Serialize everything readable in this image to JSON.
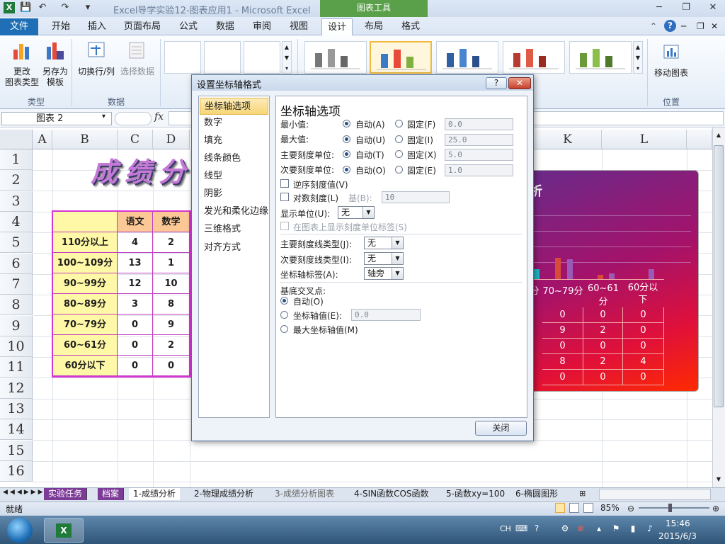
{
  "window": {
    "title": "Excel导学实验12-图表应用1 - Microsoft Excel",
    "chart_tools": "图表工具"
  },
  "ribbon": {
    "tabs": [
      "文件",
      "开始",
      "插入",
      "页面布局",
      "公式",
      "数据",
      "审阅",
      "视图",
      "设计",
      "布局",
      "格式"
    ],
    "btn_change_type": "更改\n图表类型",
    "btn_change_type_l1": "更改",
    "btn_change_type_l2": "图表类型",
    "btn_save_template_l1": "另存为",
    "btn_save_template_l2": "模板",
    "btn_switch": "切换行/列",
    "btn_select_data": "选择数据",
    "btn_move_chart": "移动图表",
    "group_type": "类型",
    "group_data": "数据",
    "group_location": "位置"
  },
  "formula": {
    "namebox": "图表 2",
    "fx": "fx"
  },
  "sheet": {
    "columns": [
      "A",
      "B",
      "C",
      "D",
      "K",
      "L"
    ],
    "rows": [
      "1",
      "2",
      "3",
      "4",
      "5",
      "6",
      "7",
      "8",
      "9",
      "10",
      "11",
      "12",
      "13",
      "14",
      "15",
      "16"
    ],
    "title_text": "成绩分",
    "table_headers": [
      "语文",
      "数学"
    ],
    "table_rows": [
      {
        "label": "110分以上",
        "c": "4",
        "d": "2"
      },
      {
        "label": "100~109分",
        "c": "13",
        "d": "1"
      },
      {
        "label": "90~99分",
        "c": "12",
        "d": "10"
      },
      {
        "label": "80~89分",
        "c": "3",
        "d": "8"
      },
      {
        "label": "70~79分",
        "c": "0",
        "d": "9"
      },
      {
        "label": "60~61分",
        "c": "0",
        "d": "2"
      },
      {
        "label": "60分以下",
        "c": "0",
        "d": "0"
      }
    ]
  },
  "chart_data": {
    "type": "table",
    "title": "析",
    "categories": [
      "分",
      "70~79分",
      "60~61分",
      "60分以下"
    ],
    "rows": [
      [
        "0",
        "0",
        "0"
      ],
      [
        "9",
        "2",
        "0"
      ],
      [
        "0",
        "0",
        "0"
      ],
      [
        "8",
        "2",
        "4"
      ],
      [
        "0",
        "0",
        "0"
      ]
    ]
  },
  "dialog": {
    "title": "设置坐标轴格式",
    "help": "?",
    "close": "✕",
    "nav": [
      "坐标轴选项",
      "数字",
      "填充",
      "线条颜色",
      "线型",
      "阴影",
      "发光和柔化边缘",
      "三维格式",
      "对齐方式"
    ],
    "heading": "坐标轴选项",
    "min_label": "最小值:",
    "max_label": "最大值:",
    "major_label": "主要刻度单位:",
    "minor_label": "次要刻度单位:",
    "auto_a": "自动(A)",
    "auto_u": "自动(U)",
    "auto_t": "自动(T)",
    "auto_o": "自动(O)",
    "fixed_f": "固定(F)",
    "fixed_i": "固定(I)",
    "fixed_x": "固定(X)",
    "fixed_e": "固定(E)",
    "min_value": "0.0",
    "max_value": "25.0",
    "major_value": "5.0",
    "minor_value": "1.0",
    "reverse": "逆序刻度值(V)",
    "log_scale": "对数刻度(L)",
    "base_label": "基(B):",
    "base_value": "10",
    "display_units": "显示单位(U):",
    "display_units_value": "无",
    "show_units_label": "在图表上显示刻度单位标签(S)",
    "major_tick_type": "主要刻度线类型(J):",
    "major_tick_value": "无",
    "minor_tick_type": "次要刻度线类型(I):",
    "minor_tick_value": "无",
    "axis_labels": "坐标轴标签(A):",
    "axis_labels_value": "轴旁",
    "floor_cross": "基底交叉点:",
    "cross_auto": "自动(O)",
    "cross_value": "坐标轴值(E):",
    "cross_value_input": "0.0",
    "cross_max": "最大坐标轴值(M)",
    "close_button": "关闭"
  },
  "sheet_tabs": [
    "实验任务",
    "档案",
    "1-成绩分析",
    "2-物理成绩分析",
    "3-成绩分析图表",
    "4-SIN函数COS函数",
    "5-函数xy=100",
    "6-椭圆图形"
  ],
  "status": {
    "ready": "就绪",
    "zoom": "85%"
  },
  "taskbar": {
    "lang": "CH",
    "time": "15:46",
    "date": "2015/6/3"
  }
}
